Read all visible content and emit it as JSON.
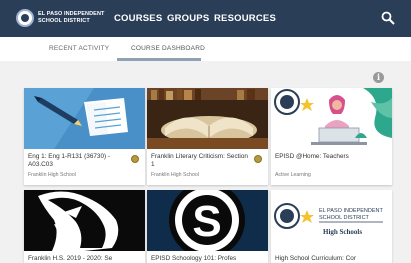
{
  "nav": {
    "brand_line1": "EL PASO INDEPENDENT",
    "brand_line2": "SCHOOL DISTRICT",
    "links": [
      "COURSES",
      "GROUPS",
      "RESOURCES"
    ]
  },
  "tabs": [
    "RECENT ACTIVITY",
    "COURSE DASHBOARD"
  ],
  "active_tab": "COURSE DASHBOARD",
  "courses": [
    {
      "title": "Eng 1: Eng 1-R131 (36730) - A03.C03",
      "school": "Franklin High School"
    },
    {
      "title": "Franklin Literary Criticism: Section 1",
      "school": "Franklin High School"
    },
    {
      "title": "EPISD @Home: Teachers",
      "school": "Active Learning"
    },
    {
      "title": "Franklin H.S. 2019 - 2020: Se",
      "school": ""
    },
    {
      "title": "EPISD Schoology 101: Profes",
      "school": ""
    },
    {
      "title": "High School Curriculum: Cor",
      "school": ""
    }
  ],
  "card_logo": {
    "line1": "EL PASO INDEPENDENT",
    "line2": "SCHOOL DISTRICT",
    "line3": "High Schools"
  },
  "colors": {
    "nav": "#2b3e57",
    "badge": "#b89a3e"
  }
}
